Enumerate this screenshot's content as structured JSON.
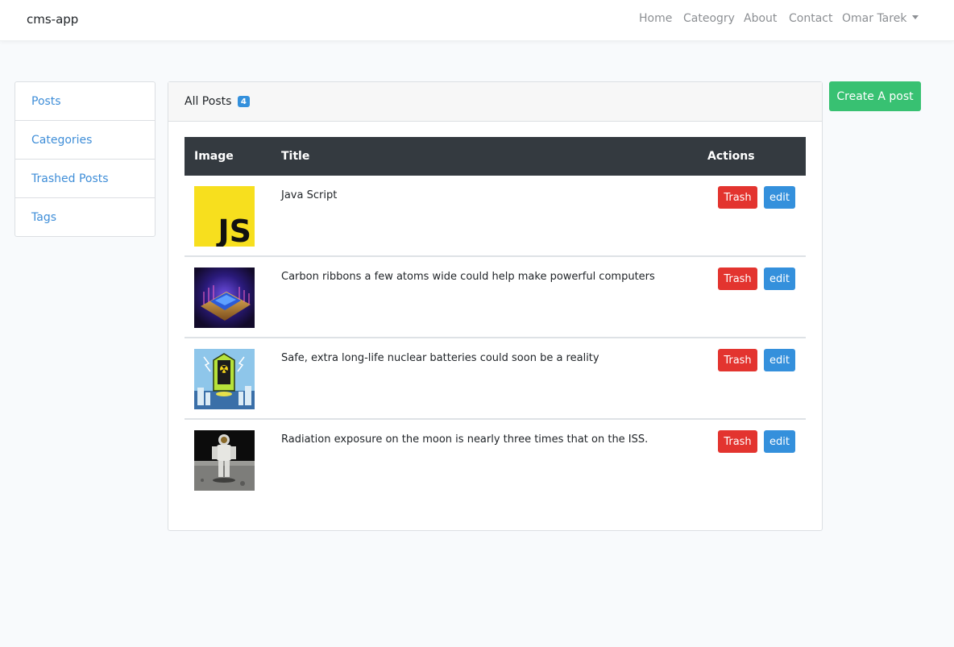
{
  "brand": "cms-app",
  "nav": {
    "home": "Home",
    "category": "Cateogry",
    "about": "About",
    "contact": "Contact",
    "user": "Omar Tarek"
  },
  "sidebar": {
    "items": [
      {
        "label": "Posts"
      },
      {
        "label": "Categories"
      },
      {
        "label": "Trashed Posts"
      },
      {
        "label": "Tags"
      }
    ]
  },
  "card": {
    "title": "All Posts",
    "count": "4"
  },
  "table": {
    "headers": {
      "image": "Image",
      "title": "Title",
      "actions": "Actions"
    },
    "rows": [
      {
        "title": "Java Script",
        "image": "js-logo",
        "trash": "Trash",
        "edit": "edit"
      },
      {
        "title": "Carbon ribbons a few atoms wide could help make powerful computers",
        "image": "cpu-chip",
        "trash": "Trash",
        "edit": "edit"
      },
      {
        "title": "Safe, extra long-life nuclear batteries could soon be a reality",
        "image": "nuclear-battery",
        "trash": "Trash",
        "edit": "edit"
      },
      {
        "title": "Radiation exposure on the moon is nearly three times that on the ISS.",
        "image": "astronaut-moon",
        "trash": "Trash",
        "edit": "edit"
      }
    ]
  },
  "create_button": "Create A post",
  "colors": {
    "link": "#3f8ed8",
    "danger": "#e3342f",
    "primary": "#3490dc",
    "success": "#38c172",
    "table_head": "#343a40",
    "js_yellow": "#f7df1e"
  }
}
